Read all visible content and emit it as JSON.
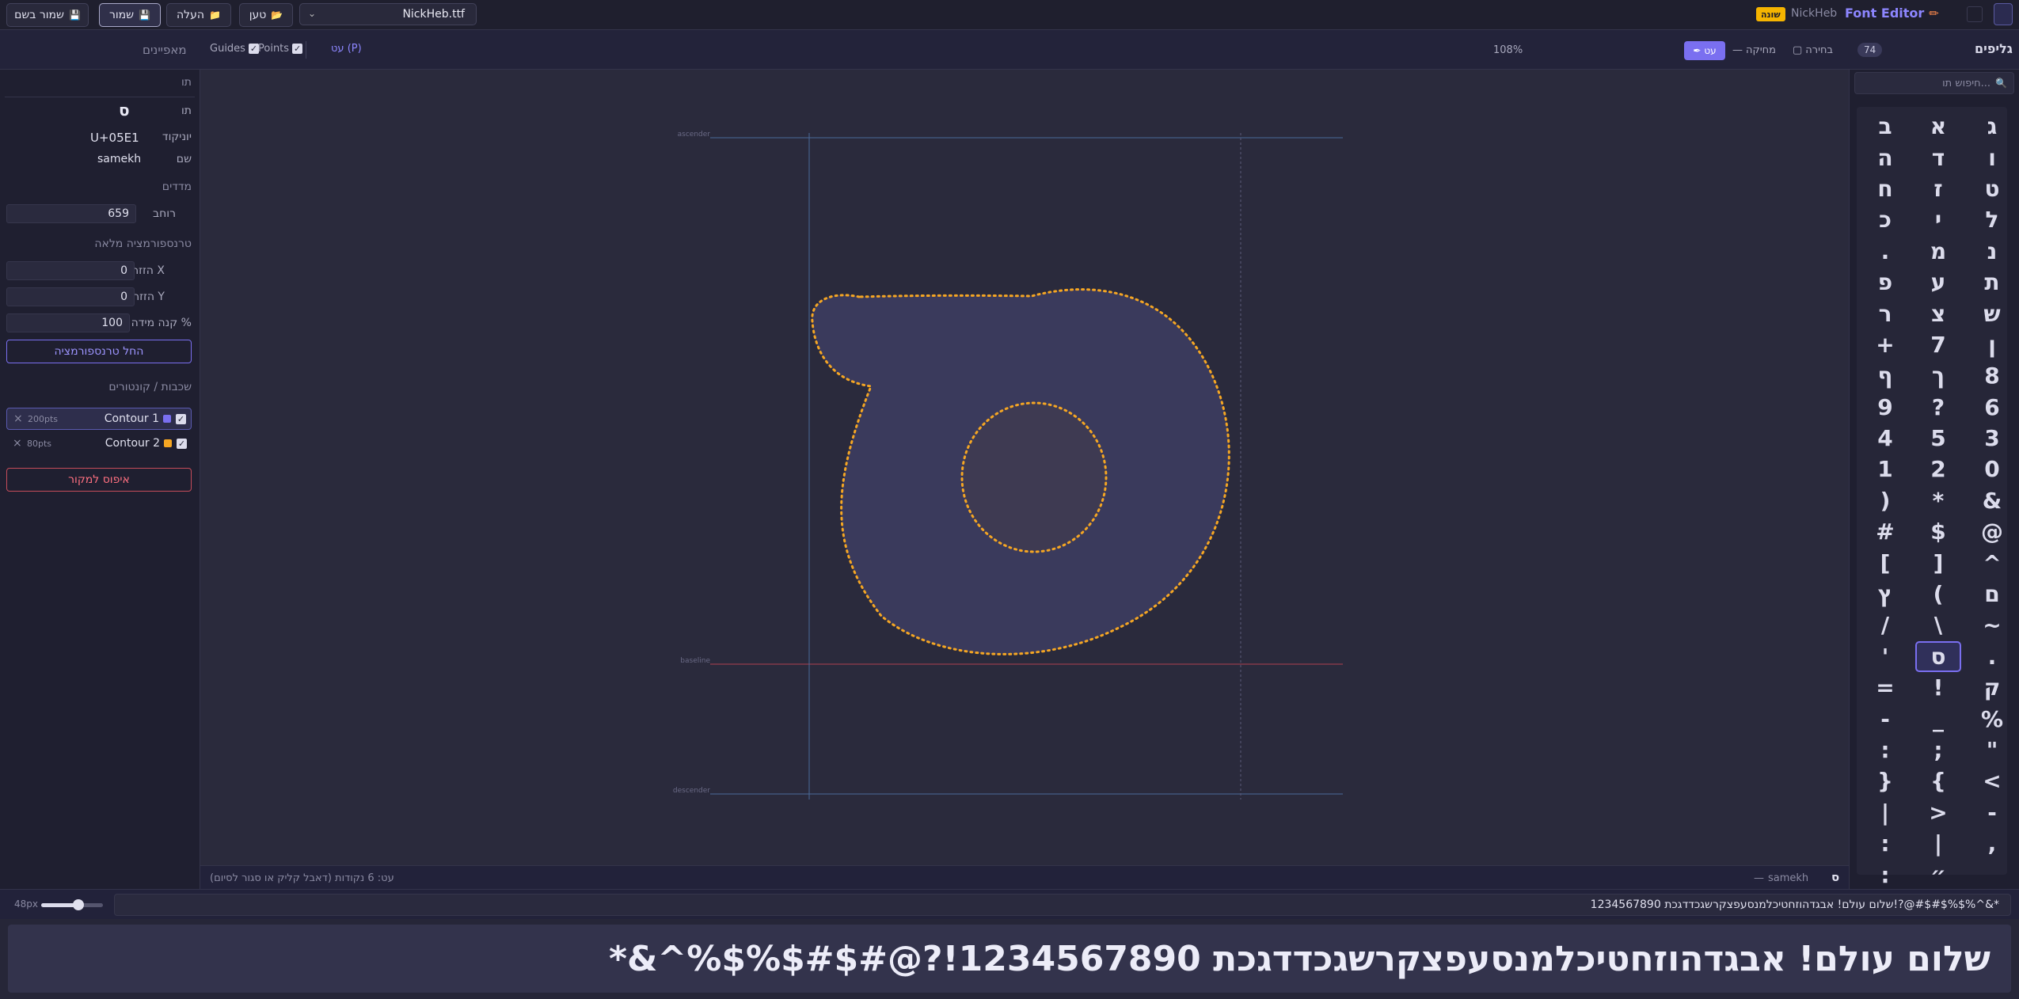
{
  "topbar": {
    "save_as": "שמור בשם",
    "save": "שמור",
    "upload": "העלה",
    "load": "טען",
    "file_name": "NickHeb.ttf",
    "brand": "Font Editor",
    "project_name": "NickHeb",
    "badge": "שונה"
  },
  "toolbar": {
    "right_title": "גליפים",
    "glyph_count": "74",
    "mode_select": "בחירה",
    "mode_erase": "מחיקה",
    "mode_pen": "עט",
    "zoom": "108%",
    "pen_hint": "עט (P)",
    "points_label": "Points",
    "guides_label": "Guides",
    "left_title": "מאפיינים"
  },
  "search": {
    "placeholder": "חיפוש תו..."
  },
  "props": {
    "section_char": "תו",
    "char_label": "תו",
    "char_value": "ס",
    "unicode_label": "יוניקוד",
    "unicode_value": "U+05E1",
    "name_label": "שם",
    "name_value": "samekh",
    "section_metrics": "מדדים",
    "width_label": "רוחב",
    "width_value": "659",
    "section_transform": "טרנספורמציה מלאה",
    "offset_x_label": "הזזה X",
    "offset_x_value": "0",
    "offset_y_label": "הזזה Y",
    "offset_y_value": "0",
    "scale_label": "קנה מידה %",
    "scale_value": "100",
    "apply_button": "החל טרנספורמציה",
    "section_layers": "שכבות / קונטורים",
    "contours": [
      {
        "name": "Contour 1",
        "pts": "200pts",
        "color": "#7a6ff0"
      },
      {
        "name": "Contour 2",
        "pts": "80pts",
        "color": "#f5a623"
      }
    ],
    "reset_button": "איפוס למקור"
  },
  "canvas": {
    "ascender": "ascender",
    "baseline": "baseline",
    "descender": "descender",
    "fill_color": "#3a3a5a",
    "point_color": "#f5a623"
  },
  "status": {
    "glyph_char": "ס",
    "glyph_name": "samekh",
    "hint": "עט: 6 נקודות (דאבל קליק או סגור לסיום)"
  },
  "bottom": {
    "size_label": "48px",
    "size_value": 0.6,
    "sample_text": "שלום עולם! אבגדהוזחטיכלמנסעפצקרשגכדדגכת 1234567890!?@#$#$%$%^&*"
  },
  "glyphs": {
    "col1": [
      "ג",
      "ו",
      "ט",
      "ל",
      "נ",
      "ת",
      "ש",
      "ן",
      "8",
      "6",
      "3",
      "0",
      "&",
      "@",
      "^",
      "ם",
      "~",
      ".",
      "ק",
      "%",
      "\"",
      "<",
      "-",
      ","
    ],
    "col2": [
      "א",
      "ד",
      "ז",
      "י",
      "מ",
      "ע",
      "צ",
      "7",
      "ך",
      "?",
      "5",
      "2",
      "*",
      "$",
      "]",
      "(",
      "\\",
      "ס",
      "!",
      "_",
      ";",
      "{",
      ">",
      "|",
      "״"
    ],
    "col3": [
      "ב",
      "ה",
      "ח",
      "כ",
      ".",
      "פ",
      "ר",
      "+",
      "ף",
      "9",
      "4",
      "1",
      ")",
      "#",
      "[",
      "ץ",
      "/",
      "'",
      "=",
      "-",
      ":",
      "}",
      "|",
      ":",
      ":"
    ],
    "selected": "ס"
  }
}
